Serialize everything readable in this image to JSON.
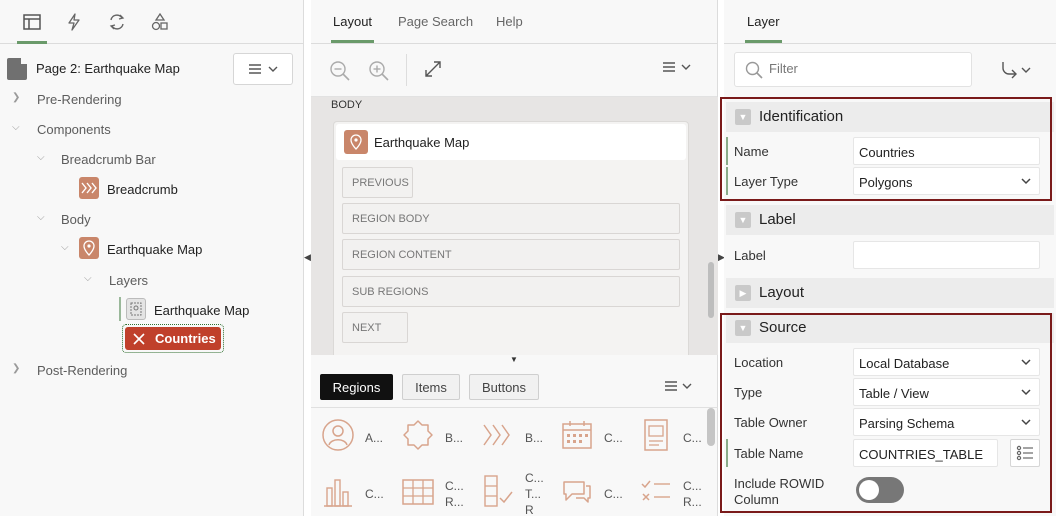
{
  "left": {
    "page_title": "Page 2: Earthquake Map",
    "tree": {
      "pre_rendering": "Pre-Rendering",
      "components": "Components",
      "breadcrumb_bar": "Breadcrumb Bar",
      "breadcrumb": "Breadcrumb",
      "body": "Body",
      "earthquake_map": "Earthquake Map",
      "layers": "Layers",
      "layer_earthquake_map": "Earthquake Map",
      "countries": "Countries",
      "post_rendering": "Post-Rendering"
    }
  },
  "middle": {
    "tabs": [
      "Layout",
      "Page Search",
      "Help"
    ],
    "canvas": {
      "body_label": "BODY",
      "region_title": "Earthquake Map",
      "slots": [
        "PREVIOUS",
        "REGION BODY",
        "REGION CONTENT",
        "SUB REGIONS",
        "NEXT"
      ]
    },
    "gallery_tabs": [
      "Regions",
      "Items",
      "Buttons"
    ],
    "gallery_items": [
      {
        "label": "A..."
      },
      {
        "label": "B..."
      },
      {
        "label": "B..."
      },
      {
        "label": "C..."
      },
      {
        "label": "C..."
      },
      {
        "label": "C..."
      },
      {
        "label": "C...\nR..."
      },
      {
        "label": "C...\nT...\nR"
      },
      {
        "label": "C..."
      },
      {
        "label": "C...\nR..."
      }
    ]
  },
  "right": {
    "tab": "Layer",
    "filter_placeholder": "Filter",
    "identification": {
      "title": "Identification",
      "name_label": "Name",
      "name_value": "Countries",
      "layer_type_label": "Layer Type",
      "layer_type_value": "Polygons"
    },
    "label_section": {
      "title": "Label",
      "label_label": "Label",
      "label_value": ""
    },
    "layout_section": {
      "title": "Layout"
    },
    "source": {
      "title": "Source",
      "location_label": "Location",
      "location_value": "Local Database",
      "type_label": "Type",
      "type_value": "Table / View",
      "table_owner_label": "Table Owner",
      "table_owner_value": "Parsing Schema",
      "table_name_label": "Table Name",
      "table_name_value": "COUNTRIES_TABLE",
      "rowid_label": "Include ROWID Column",
      "rowid_value": false
    }
  },
  "colors": {
    "accent_green": "#6a9a6a",
    "component_orange": "#c9866a",
    "selected_red": "#c0402b",
    "highlight_border": "#7a1a1a"
  }
}
